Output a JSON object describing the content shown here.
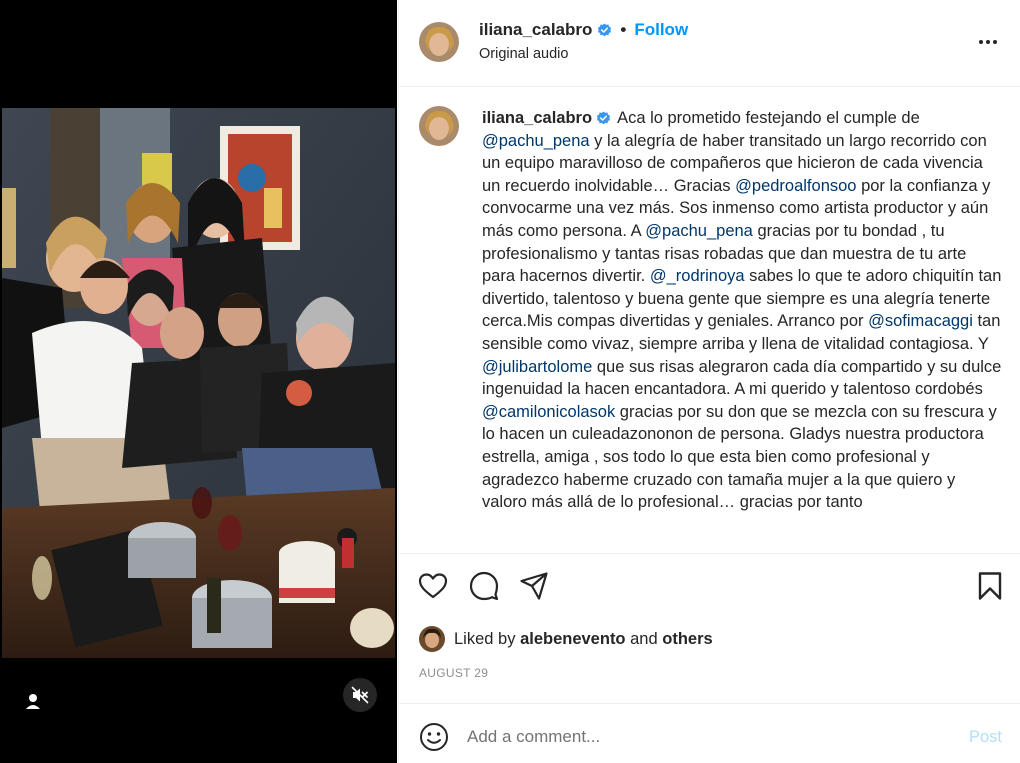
{
  "post": {
    "username": "iliana_calabro",
    "follow_label": "Follow",
    "separator": "•",
    "audio_label": "Original audio"
  },
  "caption": {
    "username": "iliana_calabro",
    "segments": [
      {
        "type": "text",
        "value": "Aca lo prometido festejando el cumple de "
      },
      {
        "type": "mention",
        "value": "@pachu_pena"
      },
      {
        "type": "text",
        "value": " y la alegría de haber transitado un largo recorrido con un equipo maravilloso de compañeros que hicieron de cada vivencia un recuerdo inolvidable… Gracias "
      },
      {
        "type": "mention",
        "value": "@pedroalfonsoo"
      },
      {
        "type": "text",
        "value": " por la confianza y convocarme una vez más. Sos inmenso como artista productor y aún más como persona. A "
      },
      {
        "type": "mention",
        "value": "@pachu_pena"
      },
      {
        "type": "text",
        "value": " gracias por tu bondad , tu profesionalismo y tantas risas robadas que dan muestra de tu arte para hacernos divertir. "
      },
      {
        "type": "mention",
        "value": "@_rodrinoya"
      },
      {
        "type": "text",
        "value": " sabes lo que te adoro chiquitín tan divertido, talentoso y buena gente que siempre es una alegría tenerte cerca.Mis compas divertidas y geniales. Arranco por "
      },
      {
        "type": "mention",
        "value": "@sofimacaggi"
      },
      {
        "type": "text",
        "value": " tan sensible como vivaz, siempre arriba y llena de vitalidad contagiosa. Y "
      },
      {
        "type": "mention",
        "value": "@julibartolome"
      },
      {
        "type": "text",
        "value": " que sus risas alegraron cada día compartido y su dulce ingenuidad la hacen encantadora. A mi querido y talentoso cordobés "
      },
      {
        "type": "mention",
        "value": "@camilonicolasok"
      },
      {
        "type": "text",
        "value": " gracias por su don que se mezcla con su frescura y lo hacen un culeadazononon de persona. Gladys nuestra productora estrella, amiga , sos todo lo que esta bien como profesional y agradezco haberme cruzado con tamaña mujer a la que quiero y valoro más allá de lo profesional… gracias por tanto"
      }
    ]
  },
  "likes": {
    "prefix": "Liked by",
    "user": "alebenevento",
    "conjunction": "and",
    "others": "others"
  },
  "date": "AUGUST 29",
  "comment": {
    "placeholder": "Add a comment...",
    "post_label": "Post"
  },
  "icons": {
    "like": "heart-icon",
    "comment": "comment-icon",
    "share": "share-icon",
    "save": "bookmark-icon",
    "more": "more-icon",
    "emoji": "emoji-icon",
    "mute": "muted-speaker-icon",
    "user_tag": "user-tag-icon",
    "verified": "verified-badge-icon"
  },
  "colors": {
    "link_blue": "#0095f6",
    "mention": "#00376b",
    "post_disabled": "#b2dffc",
    "verified": "#3897f0"
  }
}
